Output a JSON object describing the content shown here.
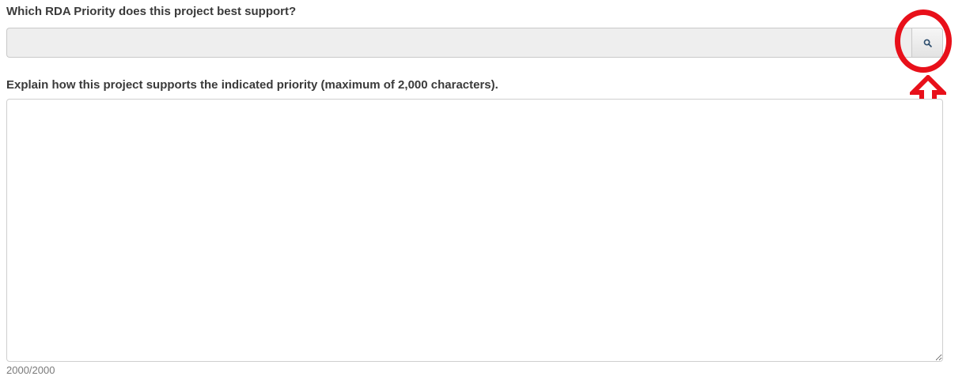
{
  "form": {
    "priority_question": {
      "label": "Which RDA Priority does this project best support?",
      "value": "",
      "lookup_icon": "search-icon"
    },
    "explanation": {
      "label": "Explain how this project supports the indicated priority (maximum of 2,000 characters).",
      "value": "",
      "counter": "2000/2000"
    }
  },
  "annotation": {
    "color": "#e8101a",
    "shapes": [
      "circle",
      "up-arrow"
    ]
  }
}
